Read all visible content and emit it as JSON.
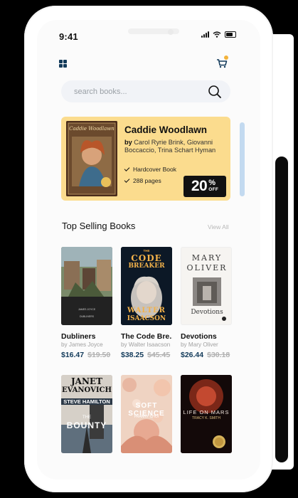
{
  "status": {
    "time": "9:41"
  },
  "search": {
    "placeholder": "search books..."
  },
  "featured": {
    "title": "Caddie Woodlawn",
    "by": "by",
    "authors": "Carol Ryrie Brink, Giovanni Boccaccio, Trina Schart Hyman",
    "features": [
      "Hardcover Book",
      "288 pages"
    ],
    "discount_value": "20",
    "discount_percent": "%",
    "discount_off": "OFF",
    "cover_title": "Caddie Woodlawn",
    "color": "#fbdc8e"
  },
  "section": {
    "title": "Top Selling Books",
    "view_all": "View All"
  },
  "books": [
    {
      "title": "Dubliners",
      "author": "by James Joyce",
      "price": "$16.47",
      "old_price": "$19.50",
      "cover_author": "JAMES JOYCE",
      "cover_title": "DUBLINERS"
    },
    {
      "title": "The Code Bre...",
      "author": "by Walter Isaacson",
      "price": "$38.25",
      "old_price": "$45.45",
      "cover_top": "THE",
      "cover_title1": "CODE",
      "cover_title2": "BREAKER",
      "cover_author1": "WALTER",
      "cover_author2": "ISAACSON"
    },
    {
      "title": "Devotions",
      "author": "by Mary Oliver",
      "price": "$26.44",
      "old_price": "$30.18",
      "cover_author1": "MARY",
      "cover_author2": "OLIVER",
      "cover_title": "Devotions"
    },
    {
      "cover_author1": "JANET",
      "cover_author2": "EVANOVICH",
      "cover_line": "STEVE HAMILTON",
      "cover_title1": "THE",
      "cover_title2": "BOUNTY"
    },
    {
      "cover_title1": "SOFT SCIENCE",
      "cover_author": "FRANNY CHOI"
    },
    {
      "cover_title": "LIFE ON MARS",
      "cover_author": "TRACY K. SMITH"
    }
  ],
  "colors": {
    "accent": "#123a5a",
    "promo": "#fbdc8e",
    "scroll": "#c3daf0"
  }
}
